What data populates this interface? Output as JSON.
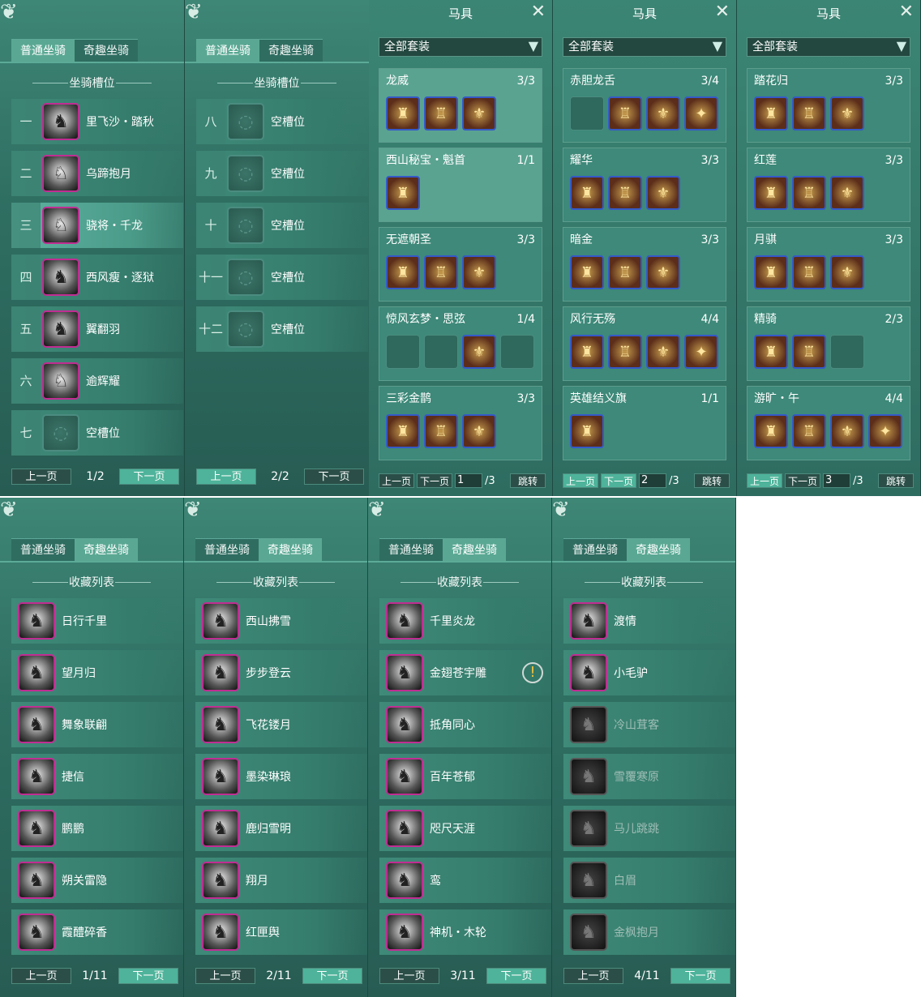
{
  "mount_tabs": {
    "normal": "普通坐骑",
    "fun": "奇趣坐骑"
  },
  "slot_title": "坐骑槽位",
  "collection_title": "收藏列表",
  "prev_label": "上一页",
  "next_label": "下一页",
  "slot_panel_1": {
    "page": "1/2",
    "rows": [
      {
        "num": "一",
        "name": "里飞沙・踏秋",
        "icon": "horse-red-icon"
      },
      {
        "num": "二",
        "name": "乌蹄抱月",
        "icon": "horse-white-icon"
      },
      {
        "num": "三",
        "name": "骁将・千龙",
        "icon": "horse-white-icon",
        "selected": true
      },
      {
        "num": "四",
        "name": "西风瘦・逐狱",
        "icon": "horse-black-icon"
      },
      {
        "num": "五",
        "name": "翼翻羽",
        "icon": "horse-black-icon"
      },
      {
        "num": "六",
        "name": "逾辉耀",
        "icon": "horse-white-icon"
      },
      {
        "num": "七",
        "name": "空槽位",
        "icon": "empty-slot-icon"
      }
    ]
  },
  "slot_panel_2": {
    "page": "2/2",
    "rows": [
      {
        "num": "八",
        "name": "空槽位"
      },
      {
        "num": "九",
        "name": "空槽位"
      },
      {
        "num": "十",
        "name": "空槽位"
      },
      {
        "num": "十一",
        "name": "空槽位"
      },
      {
        "num": "十二",
        "name": "空槽位"
      }
    ]
  },
  "gear_panels": [
    {
      "title": "马具",
      "filter": "全部套装",
      "page_input": "1",
      "page_total": "/3",
      "jump": "跳转",
      "sets": [
        {
          "name": "龙威",
          "count": "3/3",
          "slots": 3,
          "filled": 3,
          "light": true
        },
        {
          "name": "西山秘宝・魁首",
          "count": "1/1",
          "slots": 1,
          "filled": 1,
          "light": true
        },
        {
          "name": "无遮朝圣",
          "count": "3/3",
          "slots": 3,
          "filled": 3
        },
        {
          "name": "惊风玄梦・思弦",
          "count": "1/4",
          "slots": 4,
          "filled_index": [
            2
          ]
        },
        {
          "name": "三彩金鹊",
          "count": "3/3",
          "slots": 3,
          "filled": 3
        }
      ]
    },
    {
      "title": "马具",
      "filter": "全部套装",
      "page_input": "2",
      "page_total": "/3",
      "jump": "跳转",
      "sets": [
        {
          "name": "赤胆龙舌",
          "count": "3/4",
          "slots": 4,
          "filled_index": [
            1,
            2,
            3
          ]
        },
        {
          "name": "耀华",
          "count": "3/3",
          "slots": 3,
          "filled": 3
        },
        {
          "name": "暗金",
          "count": "3/3",
          "slots": 3,
          "filled": 3
        },
        {
          "name": "风行无殇",
          "count": "4/4",
          "slots": 4,
          "filled": 4
        },
        {
          "name": "英雄结义旗",
          "count": "1/1",
          "slots": 1,
          "filled": 1
        }
      ]
    },
    {
      "title": "马具",
      "filter": "全部套装",
      "page_input": "3",
      "page_total": "/3",
      "jump": "跳转",
      "sets": [
        {
          "name": "踏花归",
          "count": "3/3",
          "slots": 3,
          "filled": 3
        },
        {
          "name": "红莲",
          "count": "3/3",
          "slots": 3,
          "filled": 3
        },
        {
          "name": "月骐",
          "count": "3/3",
          "slots": 3,
          "filled": 3
        },
        {
          "name": "精骑",
          "count": "2/3",
          "slots": 3,
          "filled_index": [
            0,
            1
          ]
        },
        {
          "name": "游旷・午",
          "count": "4/4",
          "slots": 4,
          "filled": 4
        }
      ]
    }
  ],
  "collection_panels": [
    {
      "page": "1/11",
      "items": [
        {
          "name": "日行千里"
        },
        {
          "name": "望月归"
        },
        {
          "name": "舞象联翩"
        },
        {
          "name": "捷信"
        },
        {
          "name": "鹏鹏"
        },
        {
          "name": "朔关雷隐"
        },
        {
          "name": "霞醴碎香"
        }
      ]
    },
    {
      "page": "2/11",
      "items": [
        {
          "name": "西山拂雪"
        },
        {
          "name": "步步登云"
        },
        {
          "name": "飞花镂月"
        },
        {
          "name": "墨染琳琅"
        },
        {
          "name": "鹿归雪明"
        },
        {
          "name": "翔月"
        },
        {
          "name": "红匣舆"
        }
      ]
    },
    {
      "page": "3/11",
      "items": [
        {
          "name": "千里炎龙"
        },
        {
          "name": "金翅苍宇雕",
          "badge": "!"
        },
        {
          "name": "抵角同心"
        },
        {
          "name": "百年苍郁"
        },
        {
          "name": "咫尺天涯"
        },
        {
          "name": "鸾"
        },
        {
          "name": "神机・木轮"
        }
      ]
    },
    {
      "page": "4/11",
      "items": [
        {
          "name": "渡情"
        },
        {
          "name": "小毛驴"
        },
        {
          "name": "冷山茸客",
          "locked": true
        },
        {
          "name": "雪覆寒原",
          "locked": true
        },
        {
          "name": "马儿跳跳",
          "locked": true
        },
        {
          "name": "白眉",
          "locked": true
        },
        {
          "name": "金枫抱月",
          "locked": true
        }
      ]
    }
  ]
}
